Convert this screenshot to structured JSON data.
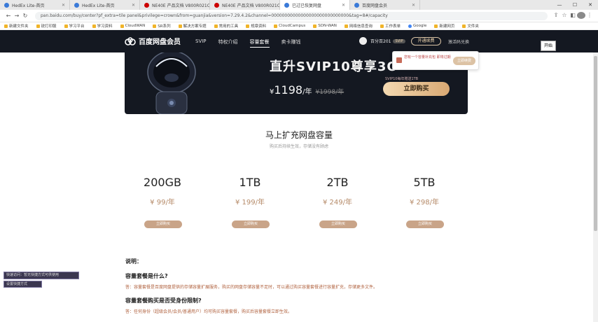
{
  "browser": {
    "tabs": [
      {
        "title": "HedEx Lite-首页",
        "active": false
      },
      {
        "title": "HedEx Lite-首页",
        "active": false
      },
      {
        "title": "NE40E 产品文档 V800R021C1",
        "active": false
      },
      {
        "title": "NE40E 产品文档 V800R021C1",
        "active": false
      },
      {
        "title": "已过已恢复网盘",
        "active": true
      },
      {
        "title": "百度网盘会员",
        "active": false
      }
    ],
    "url": "pan.baidu.com/buy/center?pf_extra=tile panel&privilege=crown&from=guanjia&version=7.29.4.2&channel=00000000000000000000000000000&tag=8#/capacity",
    "bookmarks": [
      "新建文件夹",
      "锐打印服",
      "学习平台",
      "学习资料",
      "CloudWAN",
      "SR系列",
      "解决方案专题",
      "常用的工具",
      "规章资料",
      "CloudCampus",
      "SDN-WAN",
      "网络信息查询",
      "工作表单",
      "Google",
      "新建网页",
      "文件夹"
    ]
  },
  "topnav": {
    "brand": "百度网盘会员",
    "links": [
      "SVIP",
      "特权介绍",
      "容量套餐",
      "卖卡赚钱"
    ],
    "active_index": 2,
    "username": "百分百201",
    "vip_badge": "SVIP",
    "renew_label": "开通续费",
    "cancel_label": "激活码兑换",
    "open_label": "开始"
  },
  "popup": {
    "text": "您有一个容量补充包 即将过期",
    "button": "立即续费"
  },
  "banner": {
    "headline": "直升SVIP10尊享3O",
    "yen": "¥",
    "price": "1198",
    "unit": "/年",
    "old_price": "¥1998/年",
    "buy_label": "立即购买",
    "buy_tag": "SVIP10每年赠送1TB"
  },
  "capacity": {
    "title": "马上扩充网盘容量",
    "subtitle": "购买后持续生效，存储没有顾虑"
  },
  "plans": [
    {
      "size": "200GB",
      "price": "¥ 99/年",
      "button": "立即购买"
    },
    {
      "size": "1TB",
      "price": "¥ 199/年",
      "button": "立即购买"
    },
    {
      "size": "2TB",
      "price": "¥ 249/年",
      "button": "立即购买"
    },
    {
      "size": "5TB",
      "price": "¥ 298/年",
      "button": "立即购买"
    }
  ],
  "notes": {
    "label": "说明：",
    "items": [
      {
        "q": "容量套餐是什么?",
        "a": "答：容量套餐是百度网盘提供的存储容量扩展服务，购买的网盘存储容量不足时，可以通过购买容量套餐进行容量扩充，存储更多文件。"
      },
      {
        "q": "容量套餐购买是否受身份限制?",
        "a": "答：任何身份（超级会员/会员/普通用户）均可购买容量套餐，购买后容量套餐立即生效。"
      }
    ]
  },
  "overlay": {
    "line1": "快速访问：暂无快捷方式可供使用",
    "line2": "设置快捷方式"
  },
  "colors": {
    "nav_bg": "#141821",
    "gold": "#d9a873",
    "price_color": "#b58a68",
    "button_color": "#c9a488",
    "answer_color": "#b0623f"
  }
}
